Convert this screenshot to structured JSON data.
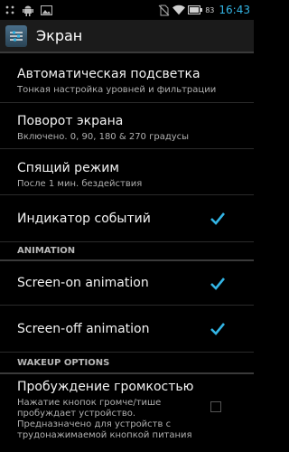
{
  "status_bar": {
    "battery_level": "83",
    "time": "16:43",
    "icons": [
      "notification-dots-icon",
      "android-robot-icon",
      "image-icon",
      "no-sim-icon",
      "wifi-icon",
      "battery-icon"
    ]
  },
  "action_bar": {
    "title": "Экран",
    "icon": "settings-display-icon"
  },
  "settings": {
    "brightness": {
      "title": "Автоматическая подсветка",
      "subtitle": "Тонкая настройка уровней и фильтрации"
    },
    "rotation": {
      "title": "Поворот экрана",
      "subtitle": "Включено. 0,  90,  180  &  270 градусы"
    },
    "sleep": {
      "title": "Спящий режим",
      "subtitle": "После 1 мин. бездействия"
    },
    "led_indicator": {
      "title": "Индикатор событий",
      "checked": true
    }
  },
  "sections": {
    "animation": "ANIMATION",
    "wakeup": "WAKEUP OPTIONS"
  },
  "animation": {
    "screen_on": {
      "title": "Screen-on animation",
      "checked": true
    },
    "screen_off": {
      "title": "Screen-off animation",
      "checked": true
    }
  },
  "wakeup": {
    "volume_wake": {
      "title": "Пробуждение громкостью",
      "desc_line1": "Нажатие кнопок громче/тише",
      "desc_line2": "пробуждает устройство.",
      "desc_line3": "Предназначено для устройств с",
      "desc_line4": "трудонажимаемой кнопкой питания",
      "checked": false
    }
  },
  "colors": {
    "accent": "#33b5e5",
    "background": "#000000",
    "action_bar": "#1b1b1b"
  }
}
